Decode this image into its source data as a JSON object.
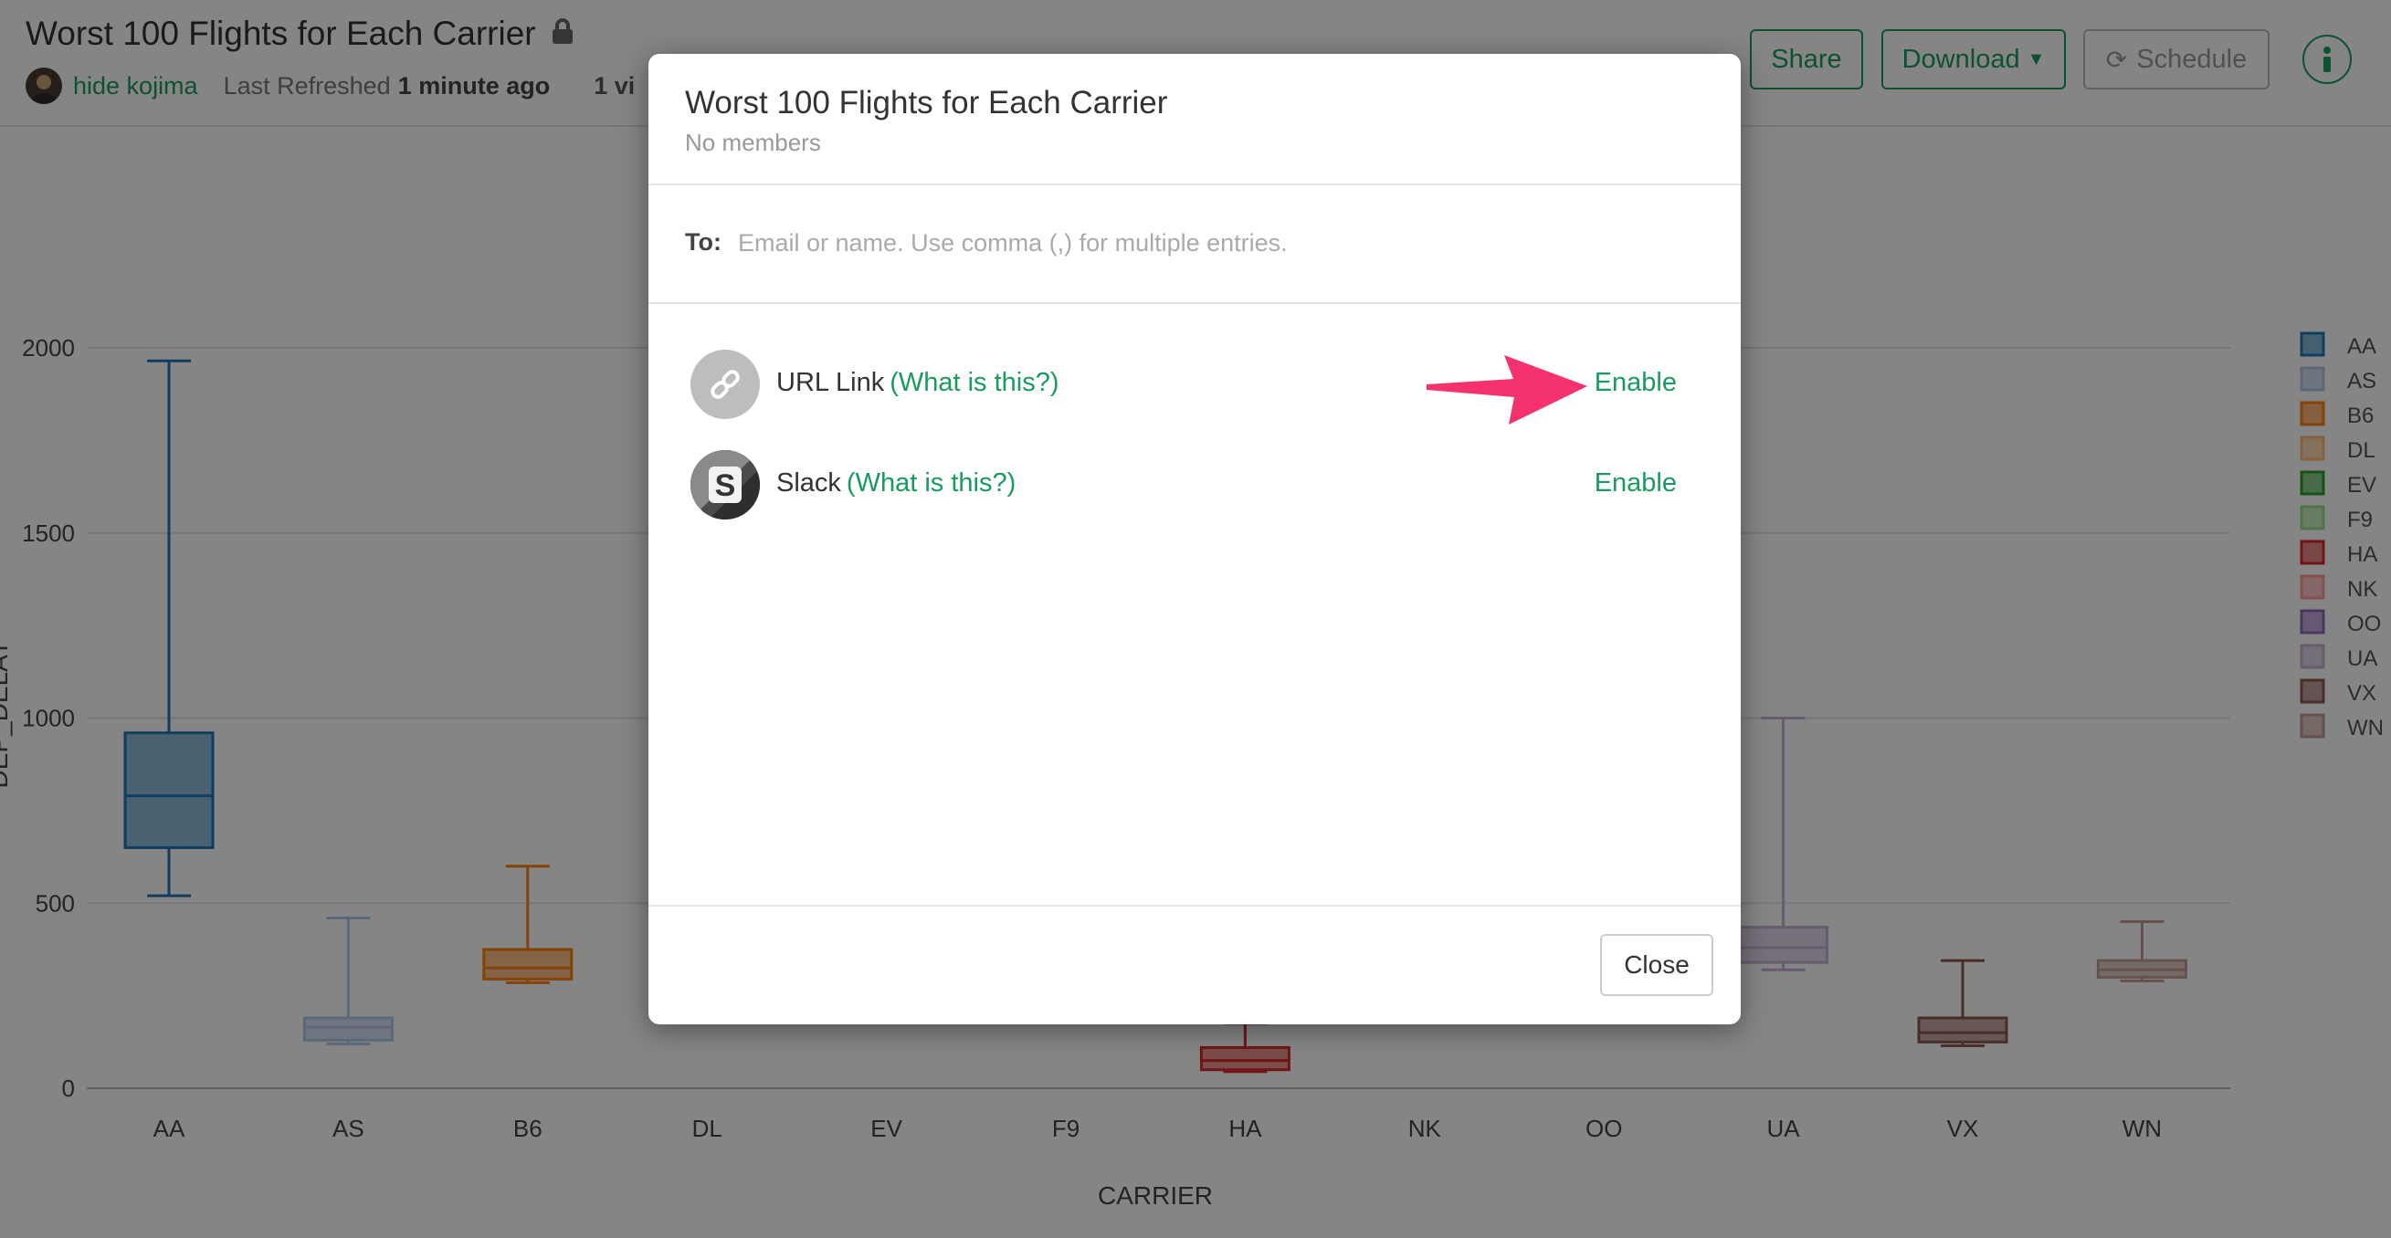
{
  "header": {
    "title": "Worst 100 Flights for Each Carrier",
    "author": "hide kojima",
    "last_refreshed_label": "Last Refreshed",
    "last_refreshed_value": "1 minute ago",
    "views_text": "1 vi",
    "share_label": "Share",
    "download_label": "Download",
    "schedule_label": "Schedule",
    "accent_color": "#1a9b5e"
  },
  "chart_data": {
    "type": "box",
    "xlabel": "CARRIER",
    "ylabel": "DEP_DELAY",
    "ylim": [
      0,
      2000
    ],
    "yticks": [
      0,
      500,
      1000,
      1500,
      2000
    ],
    "categories": [
      "AA",
      "AS",
      "B6",
      "DL",
      "EV",
      "F9",
      "HA",
      "NK",
      "OO",
      "UA",
      "VX",
      "WN"
    ],
    "legend": [
      "AA",
      "AS",
      "B6",
      "DL",
      "EV",
      "F9",
      "HA",
      "NK",
      "OO",
      "UA",
      "VX",
      "WN"
    ],
    "legend_position": "right",
    "colors": [
      "#1f77b4",
      "#aec7e8",
      "#ff7f0e",
      "#ffbb78",
      "#2ca02c",
      "#98df8a",
      "#d62728",
      "#ff9896",
      "#9467bd",
      "#c5b0d5",
      "#8c564b",
      "#c49c94"
    ],
    "visible_boxes": [
      {
        "category": "AA",
        "min": 520,
        "q1": 650,
        "median": 790,
        "q3": 960,
        "max": 1965
      },
      {
        "category": "AS",
        "min": 120,
        "q1": 130,
        "median": 165,
        "q3": 190,
        "max": 460
      },
      {
        "category": "B6",
        "min": 285,
        "q1": 295,
        "median": 325,
        "q3": 375,
        "max": 600
      },
      {
        "category": "HA",
        "min": 45,
        "q1": 50,
        "median": 75,
        "q3": 110,
        "max": 175
      },
      {
        "category": "UA",
        "min": 320,
        "q1": 340,
        "median": 380,
        "q3": 435,
        "max": 1000
      },
      {
        "category": "VX",
        "min": 115,
        "q1": 125,
        "median": 150,
        "q3": 190,
        "max": 345
      },
      {
        "category": "WN",
        "min": 290,
        "q1": 300,
        "median": 320,
        "q3": 345,
        "max": 450
      }
    ]
  },
  "modal": {
    "title": "Worst 100 Flights for Each Carrier",
    "subtitle": "No members",
    "to_label": "To:",
    "to_placeholder": "Email or name. Use comma (,) for multiple entries.",
    "options": [
      {
        "name": "URL Link",
        "help": "(What is this?)",
        "action": "Enable",
        "icon": "link-icon"
      },
      {
        "name": "Slack",
        "help": "(What is this?)",
        "action": "Enable",
        "icon": "slack-icon"
      }
    ],
    "close_label": "Close",
    "arrow_color": "#f5326e"
  }
}
